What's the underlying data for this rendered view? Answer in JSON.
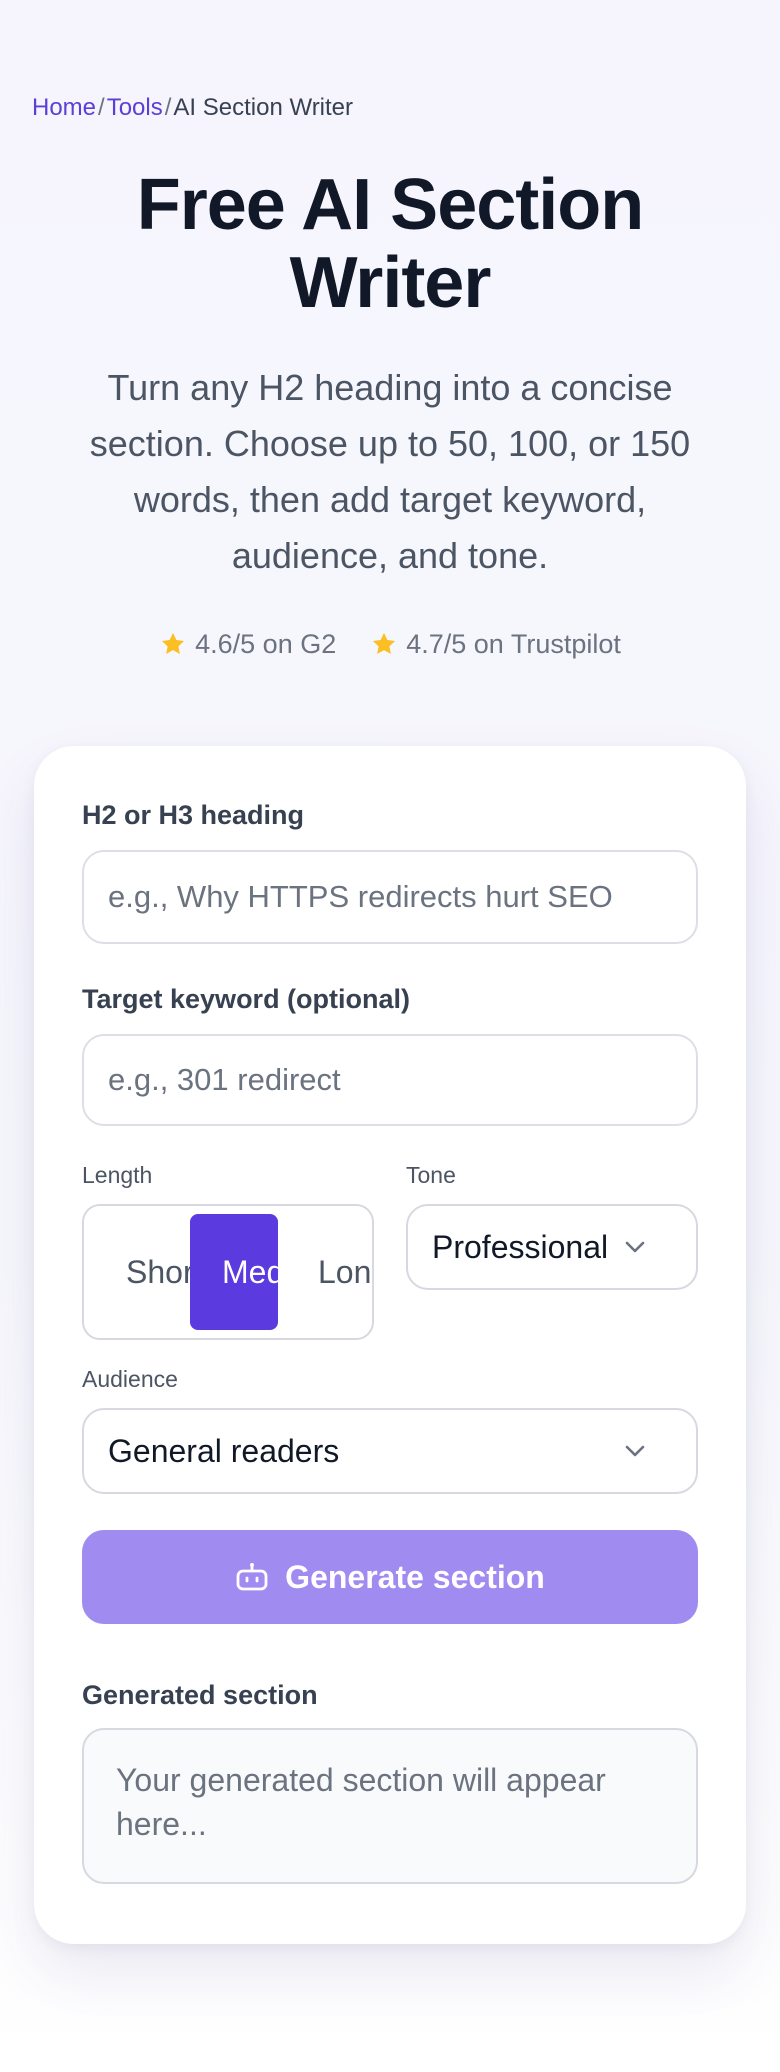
{
  "breadcrumb": {
    "home": "Home",
    "tools": "Tools",
    "current": "AI Section Writer",
    "separator": "/"
  },
  "hero": {
    "title": "Free AI Section Writer",
    "subtitle": "Turn any H2 heading into a concise section. Choose up to 50, 100, or 150 words, then add target keyword, audience, and tone."
  },
  "ratings": [
    {
      "icon": "star-icon",
      "text": "4.6/5 on G2"
    },
    {
      "icon": "star-icon",
      "text": "4.7/5 on Trustpilot"
    }
  ],
  "form": {
    "heading": {
      "label": "H2 or H3 heading",
      "value": "",
      "placeholder": "e.g., Why HTTPS redirects hurt SEO"
    },
    "keyword": {
      "label": "Target keyword (optional)",
      "value": "",
      "placeholder": "e.g., 301 redirect"
    },
    "length": {
      "label": "Length",
      "options": [
        "Short",
        "Medium",
        "Long"
      ],
      "selected": "Medium"
    },
    "tone": {
      "label": "Tone",
      "value": "Professional"
    },
    "audience": {
      "label": "Audience",
      "value": "General readers"
    },
    "generate_button": {
      "icon": "bot-icon",
      "label": "Generate section"
    },
    "output": {
      "label": "Generated section",
      "value": "",
      "placeholder": "Your generated section will appear here..."
    }
  },
  "colors": {
    "accent": "#5b3ae0",
    "button_disabled": "#a08bf0",
    "link": "#5b3fd6",
    "star": "#fbbf24"
  }
}
